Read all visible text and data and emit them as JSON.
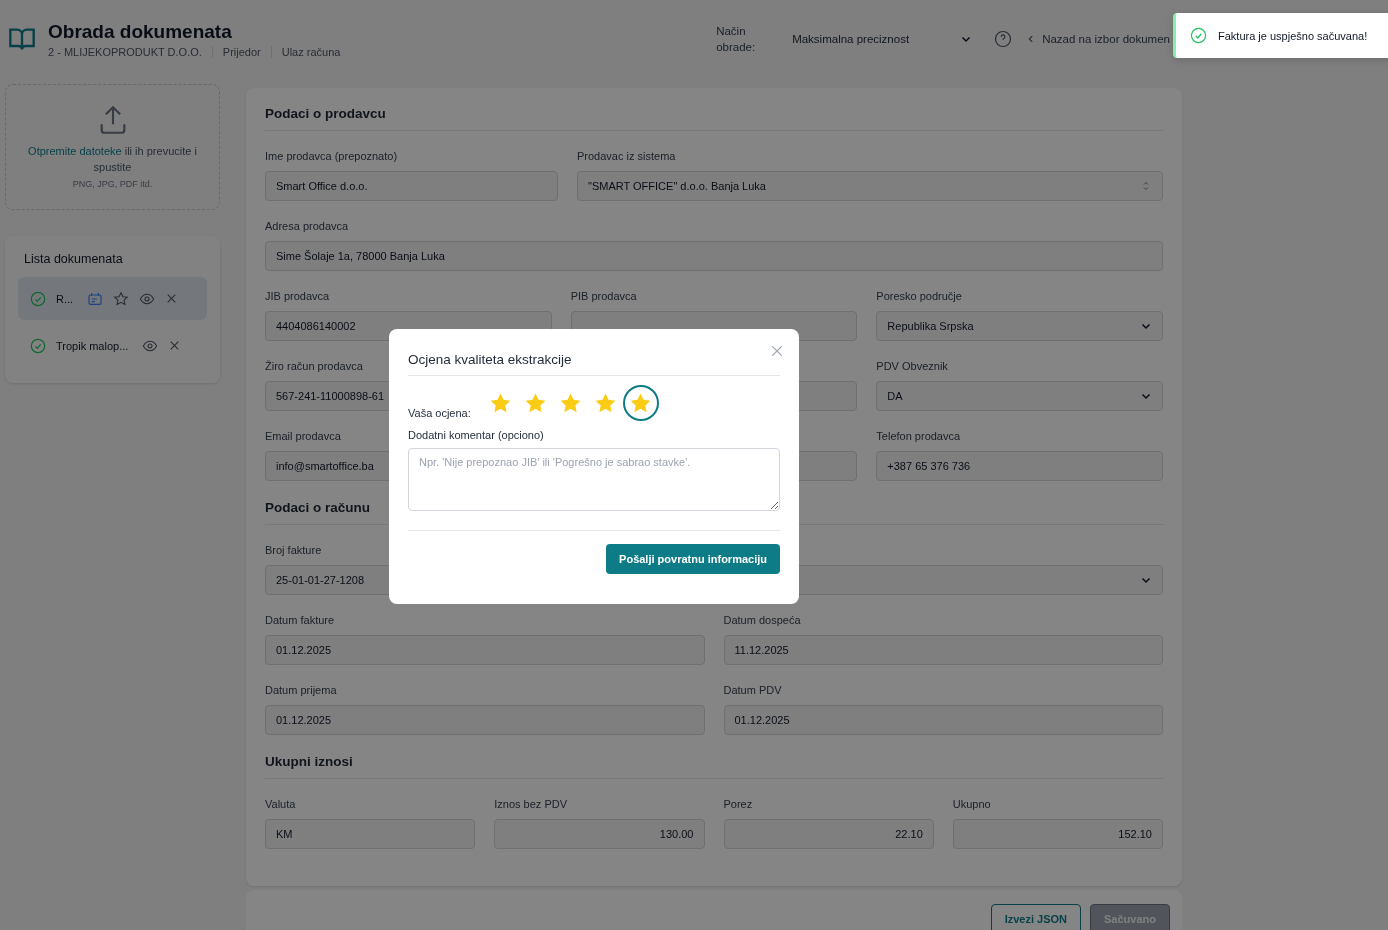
{
  "header": {
    "title": "Obrada dokumenata",
    "breadcrumbs": [
      "2 - MLIJEKOPRODUKT D.O.O.",
      "Prijedor",
      "Ulaz računa"
    ],
    "mode_label": "Način obrade:",
    "mode_value": "Maksimalna preciznost",
    "back_link": "Nazad na izbor dokumen"
  },
  "toast": {
    "text": "Faktura je uspješno sačuvana!"
  },
  "upload": {
    "link": "Otpremite datoteke",
    "text": "ili ih prevucite i spustite",
    "hint": "PNG, JPG, PDF itd."
  },
  "documents": {
    "title": "Lista dokumenata",
    "items": [
      {
        "name": "R...",
        "selected": true,
        "kind": "full"
      },
      {
        "name": "Tropik malop...",
        "selected": false,
        "kind": "basic"
      }
    ]
  },
  "sections": [
    {
      "title": "Podaci o prodavcu",
      "rows": [
        [
          {
            "label": "Ime prodavca (prepoznato)",
            "value": "Smart Office d.o.o.",
            "kind": "input"
          },
          {
            "label": "Prodavac iz sistema",
            "value": "\"SMART OFFICE\" d.o.o. Banja Luka",
            "kind": "spinner"
          }
        ],
        [
          {
            "label": "Adresa prodavca",
            "value": "Sime Šolaje 1a, 78000 Banja Luka",
            "kind": "input"
          }
        ],
        [
          {
            "label": "JIB prodavca",
            "value": "4404086140002",
            "kind": "input"
          },
          {
            "label": "PIB prodavca",
            "kind": "input"
          },
          {
            "label": "Poresko područje",
            "value": "Republika Srpska",
            "kind": "select"
          }
        ],
        [
          {
            "label": "Žiro račun prodavca",
            "value": "567-241-11000898-61",
            "kind": "input"
          },
          {
            "kind": "input"
          },
          {
            "label": "PDV Obveznik",
            "value": "DA",
            "kind": "select"
          }
        ],
        [
          {
            "label": "Email prodavca",
            "value": "info@smartoffice.ba",
            "kind": "input"
          },
          {
            "kind": "input"
          },
          {
            "label": "Telefon prodavca",
            "value": "+387 65 376 736",
            "kind": "input"
          }
        ]
      ]
    },
    {
      "title": "Podaci o računu",
      "rows": [
        [
          {
            "label": "Broj fakture",
            "value": "25-01-01-27-1208",
            "kind": "input"
          },
          {
            "kind": "select"
          }
        ],
        [
          {
            "label": "Datum fakture",
            "value": "01.12.2025",
            "kind": "input"
          },
          {
            "label": "Datum dospeća",
            "value": "11.12.2025",
            "kind": "input"
          }
        ],
        [
          {
            "label": "Datum prijema",
            "value": "01.12.2025",
            "kind": "input"
          },
          {
            "label": "Datum PDV",
            "value": "01.12.2025",
            "kind": "input"
          }
        ]
      ]
    },
    {
      "title": "Ukupni iznosi",
      "rows": [
        [
          {
            "label": "Valuta",
            "value": "KM",
            "kind": "input"
          },
          {
            "label": "Iznos bez PDV",
            "value": "130.00",
            "kind": "number"
          },
          {
            "label": "Porez",
            "value": "22.10",
            "kind": "number"
          },
          {
            "label": "Ukupno",
            "value": "152.10",
            "kind": "number"
          }
        ]
      ]
    }
  ],
  "footer": {
    "buttons": [
      {
        "label": "Izvezi JSON",
        "kind": "outline"
      },
      {
        "label": "Sačuvano",
        "kind": "disabled"
      }
    ]
  },
  "modal": {
    "title": "Ocjena kvaliteta ekstrakcije",
    "rating_label": "Vaša ocjena:",
    "stars": 5,
    "comment_label": "Dodatni komentar (opciono)",
    "comment_placeholder": "Npr. 'Nije prepoznao JIB' ili 'Pogrešno je sabrao stavke'.",
    "submit": "Pošalji povratnu informaciju"
  }
}
